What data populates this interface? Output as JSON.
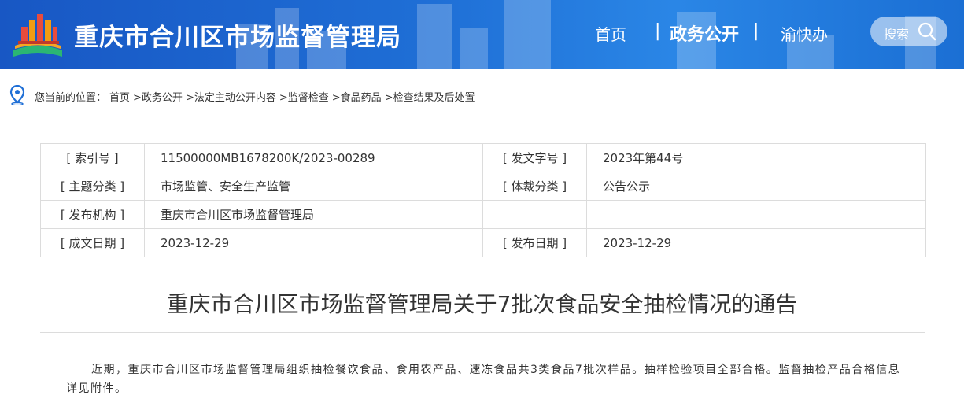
{
  "header": {
    "site_title": "重庆市合川区市场监督管理局",
    "nav": {
      "home": "首页",
      "sep": "|",
      "gov": "政务公开",
      "yu": "渝快办"
    },
    "search_label": "搜索"
  },
  "breadcrumb": {
    "prefix": "您当前的位置：",
    "items": [
      "首页",
      ">政务公开",
      ">法定主动公开内容",
      ">监督检查",
      ">食品药品",
      ">检查结果及后处置"
    ]
  },
  "meta": {
    "index_key": "[ 索引号 ]",
    "index_val": "11500000MB1678200K/2023-00289",
    "docno_key": "[ 发文字号 ]",
    "docno_val": "2023年第44号",
    "topic_key": "[ 主题分类 ]",
    "topic_val": "市场监管、安全生产监管",
    "genre_key": "[ 体裁分类 ]",
    "genre_val": "公告公示",
    "org_key": "[ 发布机构 ]",
    "org_val": "重庆市合川区市场监督管理局",
    "made_key": "[ 成文日期 ]",
    "made_val": "2023-12-29",
    "pub_key": "[ 发布日期 ]",
    "pub_val": "2023-12-29"
  },
  "article": {
    "title": "重庆市合川区市场监督管理局关于7批次食品安全抽检情况的通告",
    "body": "近期，重庆市合川区市场监督管理局组织抽检餐饮食品、食用农产品、速冻食品共3类食品7批次样品。抽样检验项目全部合格。监督抽检产品合格信息详见附件。"
  },
  "colors": {
    "header_blue": "#1f6fd6",
    "border": "#dcdcdc",
    "text": "#333333"
  }
}
